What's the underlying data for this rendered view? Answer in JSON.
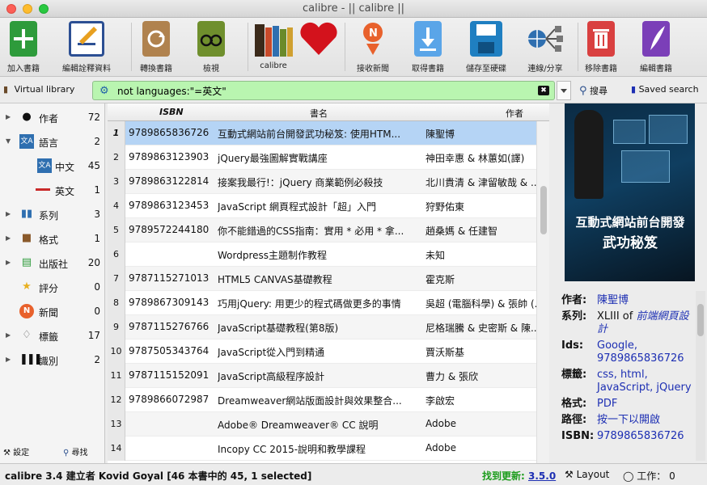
{
  "window": {
    "title": "calibre - || calibre ||"
  },
  "toolbar": {
    "items": [
      {
        "label": "加入書籍",
        "icon": "add-book-icon",
        "color": "#2e9b3b"
      },
      {
        "label": "編輯詮釋資料",
        "icon": "edit-metadata-icon",
        "color": "#2c4f93"
      },
      {
        "label": "轉換書籍",
        "icon": "convert-book-icon",
        "color": "#8a5a2b"
      },
      {
        "label": "檢視",
        "icon": "view-book-icon",
        "color": "#6f8f2d"
      },
      {
        "label": "calibre",
        "icon": "library-icon",
        "color": "#3a3a3a"
      },
      {
        "label": "",
        "icon": "heart-icon",
        "color": "#d3121c"
      },
      {
        "label": "接收新聞",
        "icon": "fetch-news-icon",
        "color": "#e8612c"
      },
      {
        "label": "取得書籍",
        "icon": "get-books-icon",
        "color": "#2f7bd2"
      },
      {
        "label": "儲存至硬碟",
        "icon": "save-disk-icon",
        "color": "#1f7fc1"
      },
      {
        "label": "連線/分享",
        "icon": "connect-share-icon",
        "color": "#2a4e8c"
      },
      {
        "label": "移除書籍",
        "icon": "remove-book-icon",
        "color": "#c92a2a"
      },
      {
        "label": "編輯書籍",
        "icon": "edit-book-icon",
        "color": "#7b3fb8"
      }
    ]
  },
  "searchbar": {
    "virtual_library": "Virtual library",
    "query": "not languages:\"=英文\"",
    "search_label": "搜尋",
    "saved_search_label": "Saved search"
  },
  "tag_browser": {
    "items": [
      {
        "name": "作者",
        "count": "72",
        "icon": "author-icon",
        "expanded": false,
        "indent": 0
      },
      {
        "name": "語言",
        "count": "2",
        "icon": "language-icon",
        "expanded": true,
        "indent": 0
      },
      {
        "name": "中文",
        "count": "45",
        "icon": "language-icon",
        "expanded": false,
        "indent": 1
      },
      {
        "name": "英文",
        "count": "1",
        "icon": "dash-icon",
        "expanded": false,
        "indent": 1
      },
      {
        "name": "系列",
        "count": "3",
        "icon": "series-icon",
        "expanded": false,
        "indent": 0
      },
      {
        "name": "格式",
        "count": "1",
        "icon": "format-icon",
        "expanded": false,
        "indent": 0
      },
      {
        "name": "出版社",
        "count": "20",
        "icon": "publisher-icon",
        "expanded": false,
        "indent": 0
      },
      {
        "name": "評分",
        "count": "0",
        "icon": "star-icon",
        "expanded": false,
        "indent": 0
      },
      {
        "name": "新聞",
        "count": "0",
        "icon": "news-icon",
        "expanded": false,
        "indent": 0
      },
      {
        "name": "標籤",
        "count": "17",
        "icon": "tag-icon",
        "expanded": false,
        "indent": 0
      },
      {
        "name": "識別",
        "count": "2",
        "icon": "barcode-icon",
        "expanded": false,
        "indent": 0
      }
    ],
    "settings_label": "設定",
    "find_label": "尋找"
  },
  "book_table": {
    "columns": [
      "ISBN",
      "書名",
      "作者"
    ],
    "rows": [
      {
        "num": "1",
        "isbn": "9789865836726",
        "title": "互動式網站前台開發武功秘笈: 使用HTM...",
        "author": "陳聖博"
      },
      {
        "num": "2",
        "isbn": "9789863123903",
        "title": "jQuery最強圖解實戰講座",
        "author": "神田幸惠 & 林蕙如(譯)"
      },
      {
        "num": "3",
        "isbn": "9789863122814",
        "title": "接案我最行!：jQuery 商業範例必殺技",
        "author": "北川貴清 & 津留敏哉 & ..."
      },
      {
        "num": "4",
        "isbn": "9789863123453",
        "title": "JavaScript 網頁程式設計「超」入門",
        "author": "狩野佑東"
      },
      {
        "num": "5",
        "isbn": "9789572244180",
        "title": "你不能錯過的CSS指南：實用 * 必用 * 拿...",
        "author": "趙桑媽 & 任建智"
      },
      {
        "num": "6",
        "isbn": "",
        "title": "Wordpress主題制作教程",
        "author": "未知"
      },
      {
        "num": "7",
        "isbn": "9787115271013",
        "title": "HTML5 CANVAS基礎教程",
        "author": "霍克斯"
      },
      {
        "num": "8",
        "isbn": "9789867309143",
        "title": "巧用jQuery: 用更少的程式碼做更多的事情",
        "author": "吳超 (電腦科學) & 張帥 (..."
      },
      {
        "num": "9",
        "isbn": "9787115276766",
        "title": "JavaScript基礎教程(第8版)",
        "author": "尼格瑞騰 & 史密斯 & 陳..."
      },
      {
        "num": "10",
        "isbn": "9787505343764",
        "title": "JavaScript從入門到精通",
        "author": "賈沃斯基"
      },
      {
        "num": "11",
        "isbn": "9787115152091",
        "title": "JavaScript高級程序設計",
        "author": "曹力 & 張欣"
      },
      {
        "num": "12",
        "isbn": "9789866072987",
        "title": "Dreamweaver網站版面設計與效果整合...",
        "author": "李啟宏"
      },
      {
        "num": "13",
        "isbn": "",
        "title": "Adobe® Dreamweaver® CC 說明",
        "author": "Adobe"
      },
      {
        "num": "14",
        "isbn": "",
        "title": "Incopy CC 2015-說明和教學課程",
        "author": "Adobe"
      }
    ]
  },
  "details": {
    "cover": {
      "title_line1": "互動式網站前台開發",
      "title_line2": "武功秘笈"
    },
    "fields": [
      {
        "key": "作者:",
        "value": "陳聖博",
        "link": true
      },
      {
        "key": "系列:",
        "value": "XLIII of",
        "value2": "前端網頁設計",
        "link": false
      },
      {
        "key": "Ids:",
        "value": "Google, 9789865836726",
        "link": true
      },
      {
        "key": "標籤:",
        "value": "css, html, JavaScript, jQuery",
        "link": true
      },
      {
        "key": "格式:",
        "value": "PDF",
        "link": true
      },
      {
        "key": "路徑:",
        "value": "按一下以開啟",
        "link": true
      },
      {
        "key": "ISBN:",
        "value": "9789865836726",
        "link": true
      }
    ]
  },
  "statusbar": {
    "left": "calibre 3.4 建立者 Kovid Goyal  [46  本書中的 45, 1 selected]",
    "update_prefix": "找到更新:",
    "update_version": "3.5.0",
    "layout_label": "Layout",
    "jobs_label": "工作： 0"
  }
}
